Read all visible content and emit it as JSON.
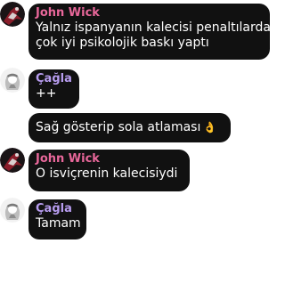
{
  "messages": [
    {
      "sender": "John Wick",
      "lines": [
        "Yalnız ispanyanın kalecisi penaltılarda",
        "çok iyi psikolojik baskı yaptı"
      ],
      "avatar": "john-wick-avatar"
    },
    {
      "sender": "Çağla",
      "lines": [
        "++"
      ],
      "avatar": "cagla-avatar"
    },
    {
      "sender": "",
      "lines": [
        "Sağ gösterip sola atlaması"
      ],
      "emoji": "👌"
    },
    {
      "sender": "John Wick",
      "lines": [
        "O isviçrenin kalecisiydi"
      ],
      "avatar": "john-wick-avatar"
    },
    {
      "sender": "Çağla",
      "lines": [
        "Tamam"
      ],
      "avatar": "cagla-avatar"
    }
  ],
  "colors": {
    "bubble_bg": "#111111",
    "bubble_text": "#ffffff",
    "john_name": "#e8679a",
    "cagla_name": "#b89df0"
  }
}
